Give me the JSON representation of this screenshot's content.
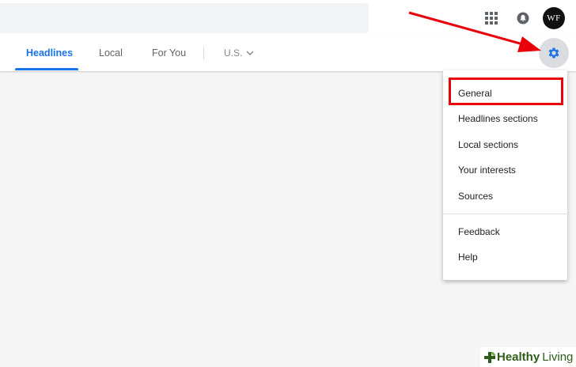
{
  "header": {
    "search_value": "",
    "avatar_initials": "WF"
  },
  "nav": {
    "tabs": [
      {
        "label": "Headlines",
        "active": true
      },
      {
        "label": "Local",
        "active": false
      },
      {
        "label": "For You",
        "active": false
      }
    ],
    "region_label": "U.S."
  },
  "settings_menu": {
    "items": [
      {
        "label": "General",
        "highlighted": true
      },
      {
        "label": "Headlines sections"
      },
      {
        "label": "Local sections"
      },
      {
        "label": "Your interests"
      },
      {
        "label": "Sources"
      }
    ],
    "secondary_items": [
      {
        "label": "Feedback"
      },
      {
        "label": "Help"
      }
    ]
  },
  "icons": {
    "apps": "apps-grid-icon",
    "notifications": "bell-icon",
    "settings": "gear-icon",
    "region_toggle": "chevron-down-icon"
  },
  "colors": {
    "accent": "#1a73e8",
    "annotation": "#e8000b",
    "watermark": "#2e5d1a"
  },
  "watermark": {
    "brand_bold": "Healthy",
    "brand_light": "Living"
  }
}
